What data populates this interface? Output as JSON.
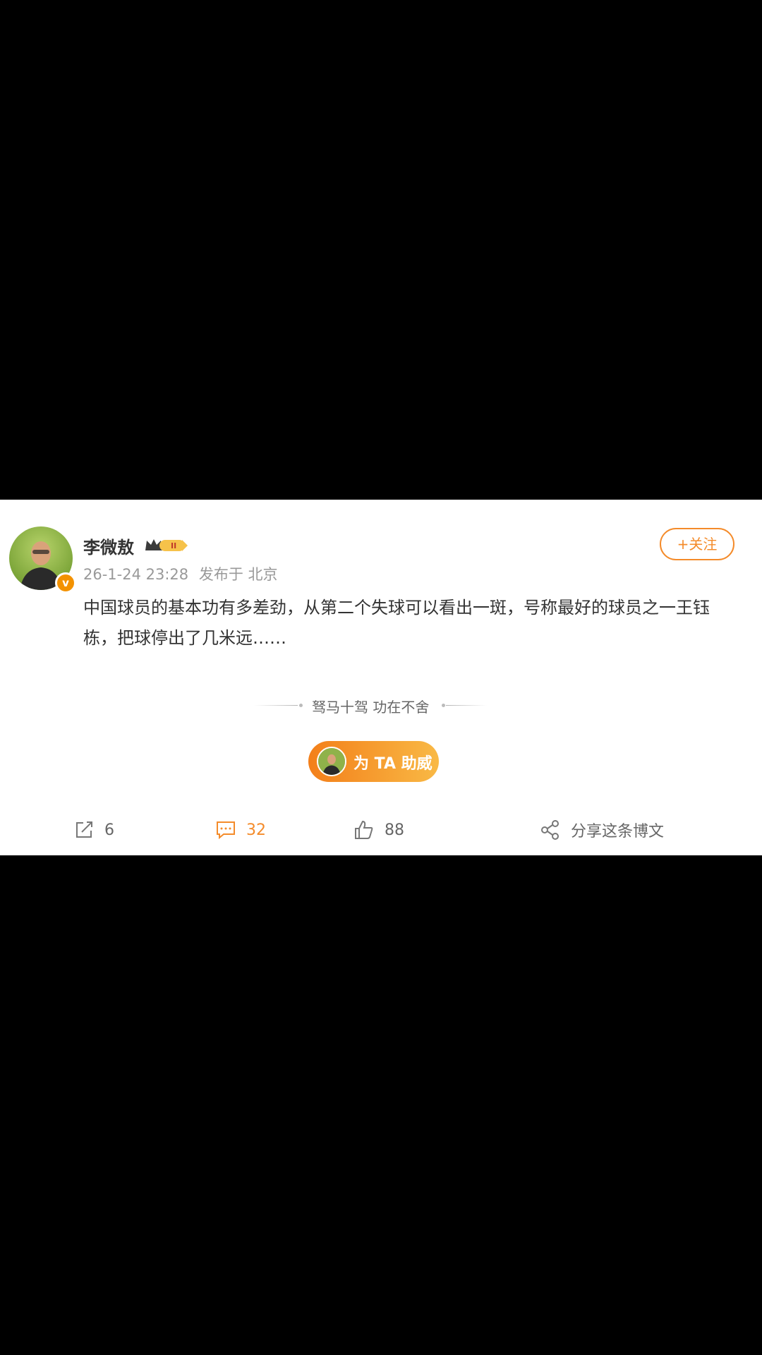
{
  "post": {
    "username": "李微敖",
    "date": "26-1-24 23:28",
    "location": "发布于 北京",
    "follow_label": "+关注",
    "text": "中国球员的基本功有多差劲，从第二个失球可以看出一斑，号称最好的球员之一王钰栋，把球停出了几米远……",
    "vip_level": "II"
  },
  "divider": {
    "text": "驽马十驾 功在不舍"
  },
  "cheer": {
    "label": "为 TA 助威"
  },
  "actions": {
    "reposts": "6",
    "comments": "32",
    "likes": "88",
    "share_label": "分享这条博文"
  },
  "colors": {
    "accent": "#f48b2a",
    "background": "#000000",
    "card": "#ffffff",
    "text": "#333333",
    "muted": "#999999"
  },
  "icons": [
    "repost-icon",
    "comment-icon",
    "like-icon",
    "share-icon",
    "crown-icon",
    "verified-v-icon"
  ]
}
